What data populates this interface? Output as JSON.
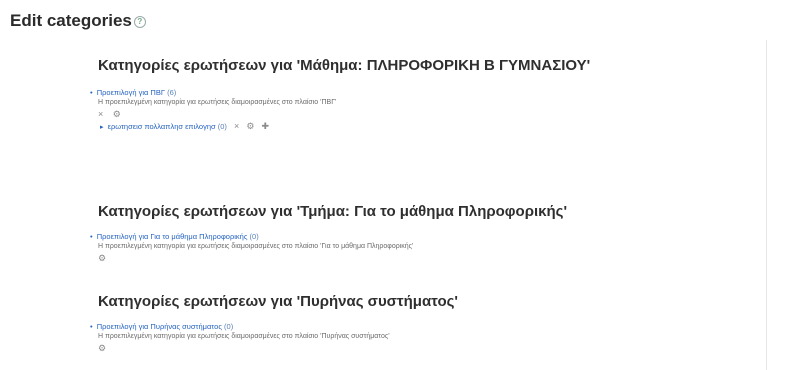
{
  "page": {
    "title": "Edit categories"
  },
  "sections": [
    {
      "heading": "Κατηγορίες ερωτήσεων για 'Μάθημα: ΠΛΗΡΟΦΟΡΙΚΗ Β ΓΥΜΝΑΣΙΟΥ'",
      "category": {
        "name": "Προεπιλογή για ΠΒΓ",
        "count": "(6)",
        "info": "Η προεπιλεγμένη κατηγορία για ερωτήσεις διαμοιρασμένες στο πλαίσιο 'ΠΒΓ'"
      },
      "child": {
        "name": "ερωτησεισ πολλαπλησ επιλογησ",
        "count": "(0)"
      }
    },
    {
      "heading": "Κατηγορίες ερωτήσεων για 'Τμήμα: Για το μάθημα Πληροφορικής'",
      "category": {
        "name": "Προεπιλογή για Για το μάθημα Πληροφορικής",
        "count": "(0)",
        "info": "Η προεπιλεγμένη κατηγορία για ερωτήσεις διαμοιρασμένες στο πλαίσιο 'Για το μάθημα Πληροφορικής'"
      }
    },
    {
      "heading": "Κατηγορίες ερωτήσεων για 'Πυρήνας συστήματος'",
      "category": {
        "name": "Προεπιλογή για Πυρήνας συστήματος",
        "count": "(0)",
        "info": "Η προεπιλεγμένη κατηγορία για ερωτήσεις διαμοιρασμένες στο πλαίσιο 'Πυρήνας συστήματος'"
      }
    }
  ],
  "icons": {
    "help": "?",
    "delete": "×",
    "settings": "⚙",
    "add": "✚",
    "caret": "▸"
  }
}
